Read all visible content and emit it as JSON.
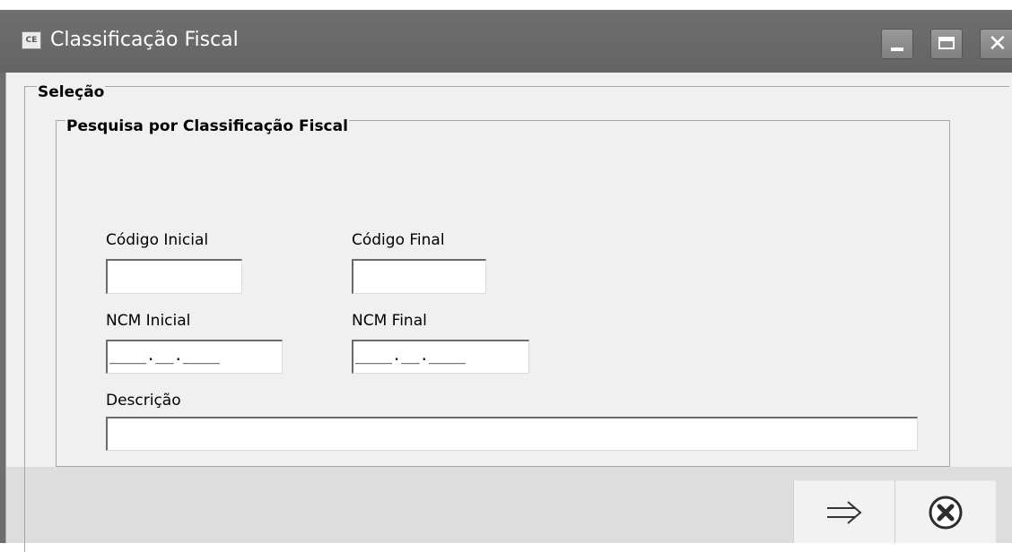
{
  "window": {
    "title": "Classificação Fiscal",
    "icon": "CE"
  },
  "selection": {
    "legend": "Seleção",
    "search_group": {
      "legend": "Pesquisa por Classificação Fiscal",
      "fields": {
        "codigo_inicial": {
          "label": "Código Inicial",
          "value": ""
        },
        "codigo_final": {
          "label": "Código Final",
          "value": ""
        },
        "ncm_inicial": {
          "label": "NCM Inicial",
          "mask": "____.__.____"
        },
        "ncm_final": {
          "label": "NCM Final",
          "mask": "____.__.____"
        },
        "descricao": {
          "label": "Descrição",
          "value": ""
        }
      }
    }
  },
  "actions": {
    "confirm_icon": "arrow-right-icon",
    "cancel_icon": "close-circle-icon"
  },
  "colors": {
    "titlebar": "#6d6d6d",
    "client": "#f0f0f0",
    "footer": "#dddddd"
  }
}
